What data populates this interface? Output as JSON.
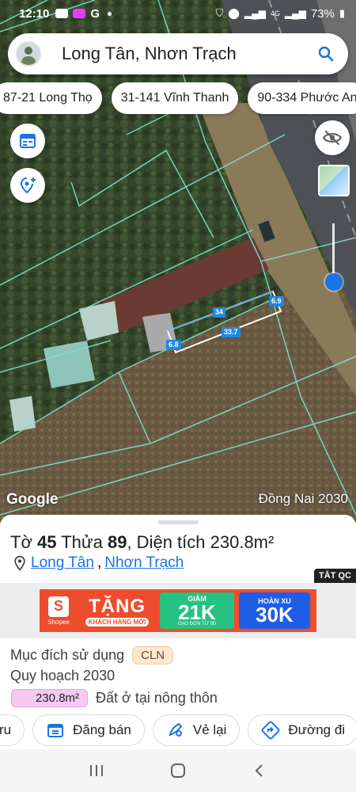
{
  "status_bar": {
    "time": "12:10",
    "battery": "73%",
    "network": "4G"
  },
  "search": {
    "query": "Long Tân, Nhơn Trạch"
  },
  "chips": [
    {
      "label": "87-21 Long Thọ"
    },
    {
      "label": "31-141 Vĩnh Thanh"
    },
    {
      "label": "90-334 Phước An"
    }
  ],
  "map": {
    "dimensions": [
      "34",
      "33.7",
      "6.8",
      "6.9"
    ],
    "google_label": "Google",
    "watermark": "Đồng Nai 2030",
    "colors": {
      "parcel_lines": "#7fe0d0",
      "highlight": "#1e88e5"
    }
  },
  "parcel": {
    "title_prefix": "Tờ",
    "sheet_no": "45",
    "plot_word": "Thửa",
    "plot_no": "89",
    "area_prefix": ", Diện tích",
    "area": "230.8m²",
    "commune": "Long Tân",
    "separator": ",",
    "district": "Nhơn Trạch",
    "ad_tag": "TẮT QC",
    "purpose_label": "Mục đích sử dụng",
    "purpose_code": "CLN",
    "plan_label": "Quy hoạch 2030",
    "plan_area": "230.8m²",
    "plan_type": "Đất ở tại nông thôn"
  },
  "ad": {
    "brand": "Shopee",
    "headline": "TẶNG",
    "subline": "KHÁCH HÀNG MỚI",
    "offer1_top": "GIẢM",
    "offer1_value": "21K",
    "offer1_note": "CHO ĐƠN TỪ 0Đ",
    "offer2_top": "HOÀN XU",
    "offer2_value": "30K"
  },
  "actions": [
    {
      "label": "ru",
      "icon": "unknown-icon"
    },
    {
      "label": "Đăng bán",
      "icon": "listing-icon"
    },
    {
      "label": "Vẻ lại",
      "icon": "draw-icon"
    },
    {
      "label": "Đường đi",
      "icon": "directions-icon"
    }
  ]
}
